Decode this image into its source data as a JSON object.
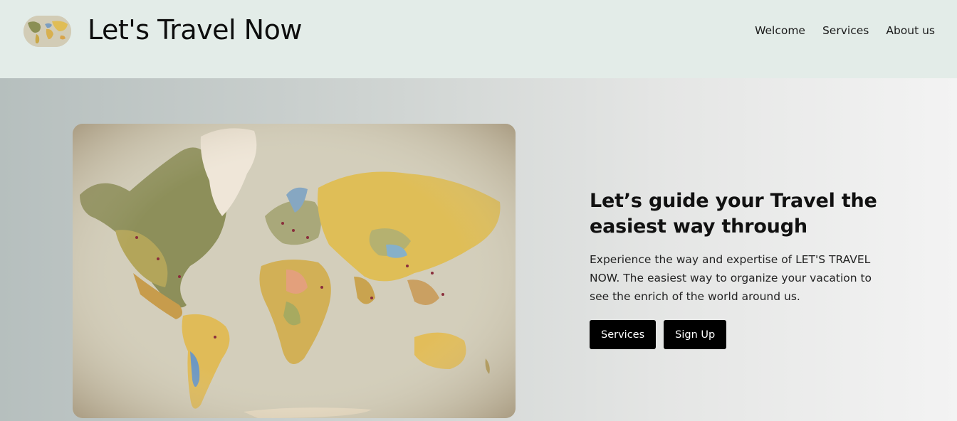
{
  "header": {
    "brand": "Let's Travel Now",
    "logo": "world-map-thumbnail",
    "nav": [
      "Welcome",
      "Services",
      "About us"
    ]
  },
  "hero": {
    "image": "world-map-with-pins",
    "headline": "Let’s guide your Travel the easiest way through",
    "description": "Experience the way and expertise of LET'S TRAVEL NOW. The easiest way to organize your vacation to see the enrich of the world around us.",
    "buttons": [
      "Services",
      "Sign Up"
    ]
  }
}
